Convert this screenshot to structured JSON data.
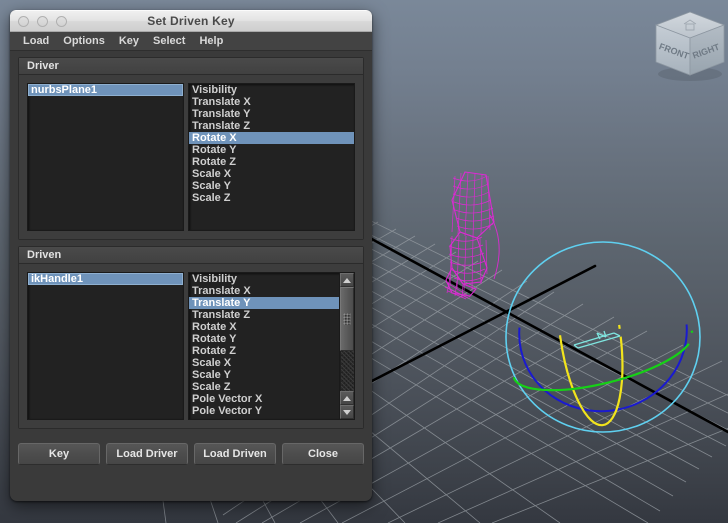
{
  "window": {
    "title": "Set Driven Key",
    "traffic_lights": [
      "close-button",
      "minimize-button",
      "zoom-button"
    ],
    "menu": [
      {
        "label": "Load"
      },
      {
        "label": "Options"
      },
      {
        "label": "Key"
      },
      {
        "label": "Select"
      },
      {
        "label": "Help"
      }
    ]
  },
  "driver": {
    "header": "Driver",
    "nodes": [
      {
        "label": "nurbsPlane1",
        "selected": true
      }
    ],
    "attributes": [
      {
        "label": "Visibility",
        "selected": false
      },
      {
        "label": "Translate X",
        "selected": false
      },
      {
        "label": "Translate Y",
        "selected": false
      },
      {
        "label": "Translate Z",
        "selected": false
      },
      {
        "label": "Rotate X",
        "selected": true
      },
      {
        "label": "Rotate Y",
        "selected": false
      },
      {
        "label": "Rotate Z",
        "selected": false
      },
      {
        "label": "Scale X",
        "selected": false
      },
      {
        "label": "Scale Y",
        "selected": false
      },
      {
        "label": "Scale Z",
        "selected": false
      }
    ],
    "has_scrollbar": false
  },
  "driven": {
    "header": "Driven",
    "nodes": [
      {
        "label": "ikHandle1",
        "selected": true
      }
    ],
    "attributes": [
      {
        "label": "Visibility",
        "selected": false
      },
      {
        "label": "Translate X",
        "selected": false
      },
      {
        "label": "Translate Y",
        "selected": true
      },
      {
        "label": "Translate Z",
        "selected": false
      },
      {
        "label": "Rotate X",
        "selected": false
      },
      {
        "label": "Rotate Y",
        "selected": false
      },
      {
        "label": "Rotate Z",
        "selected": false
      },
      {
        "label": "Scale X",
        "selected": false
      },
      {
        "label": "Scale Y",
        "selected": false
      },
      {
        "label": "Scale Z",
        "selected": false
      },
      {
        "label": "Pole Vector X",
        "selected": false
      },
      {
        "label": "Pole Vector Y",
        "selected": false
      }
    ],
    "has_scrollbar": true
  },
  "footer": {
    "buttons": [
      {
        "label": "Key"
      },
      {
        "label": "Load Driver"
      },
      {
        "label": "Load Driven"
      },
      {
        "label": "Close"
      }
    ]
  },
  "viewport": {
    "view_cube": {
      "front_label": "FRONT",
      "right_label": "RIGHT"
    },
    "colors": {
      "background_top": "#7a8899",
      "background_bottom": "#343840",
      "grid": "#9aa0a6",
      "axis": "#000000",
      "mesh_wireframe": "#e327d8",
      "manipulator_outer": "#5fd0f0",
      "manipulator_x": "#16d116",
      "manipulator_y": "#f2e41c",
      "manipulator_z": "#1a1ad0",
      "selection_highlight": "#6f93ba"
    },
    "objects": [
      {
        "name": "leg-wireframe-mesh",
        "color": "#e327d8"
      },
      {
        "name": "rotate-manipulator",
        "color": "#5fd0f0"
      },
      {
        "name": "ground-grid",
        "color": "#9aa0a6"
      }
    ]
  }
}
